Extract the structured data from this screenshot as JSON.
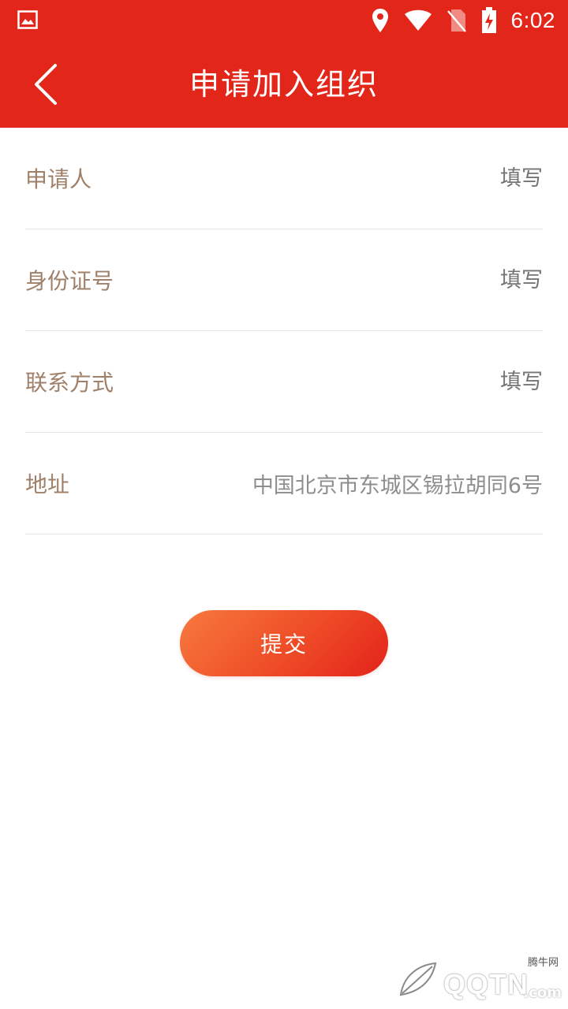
{
  "status_bar": {
    "time": "6:02",
    "icons": [
      "gallery-icon",
      "location-icon",
      "wifi-icon",
      "no-sim-icon",
      "battery-charging-icon"
    ]
  },
  "app_bar": {
    "title": "申请加入组织",
    "back_icon": "chevron-left-icon"
  },
  "form": {
    "rows": [
      {
        "label": "申请人",
        "placeholder": "填写",
        "value": ""
      },
      {
        "label": "身份证号",
        "placeholder": "填写",
        "value": ""
      },
      {
        "label": "联系方式",
        "placeholder": "填写",
        "value": ""
      },
      {
        "label": "地址",
        "placeholder": "",
        "value": "中国北京市东城区锡拉胡同6号"
      }
    ]
  },
  "submit": {
    "label": "提交"
  },
  "watermark": {
    "site_cn": "腾牛网",
    "brand": "QQTN",
    "com": ".com"
  },
  "colors": {
    "primary": "#e3261a",
    "label": "#a08068",
    "value": "#8e8e8e",
    "button_start": "#f77a3f",
    "button_end": "#e3231a"
  }
}
